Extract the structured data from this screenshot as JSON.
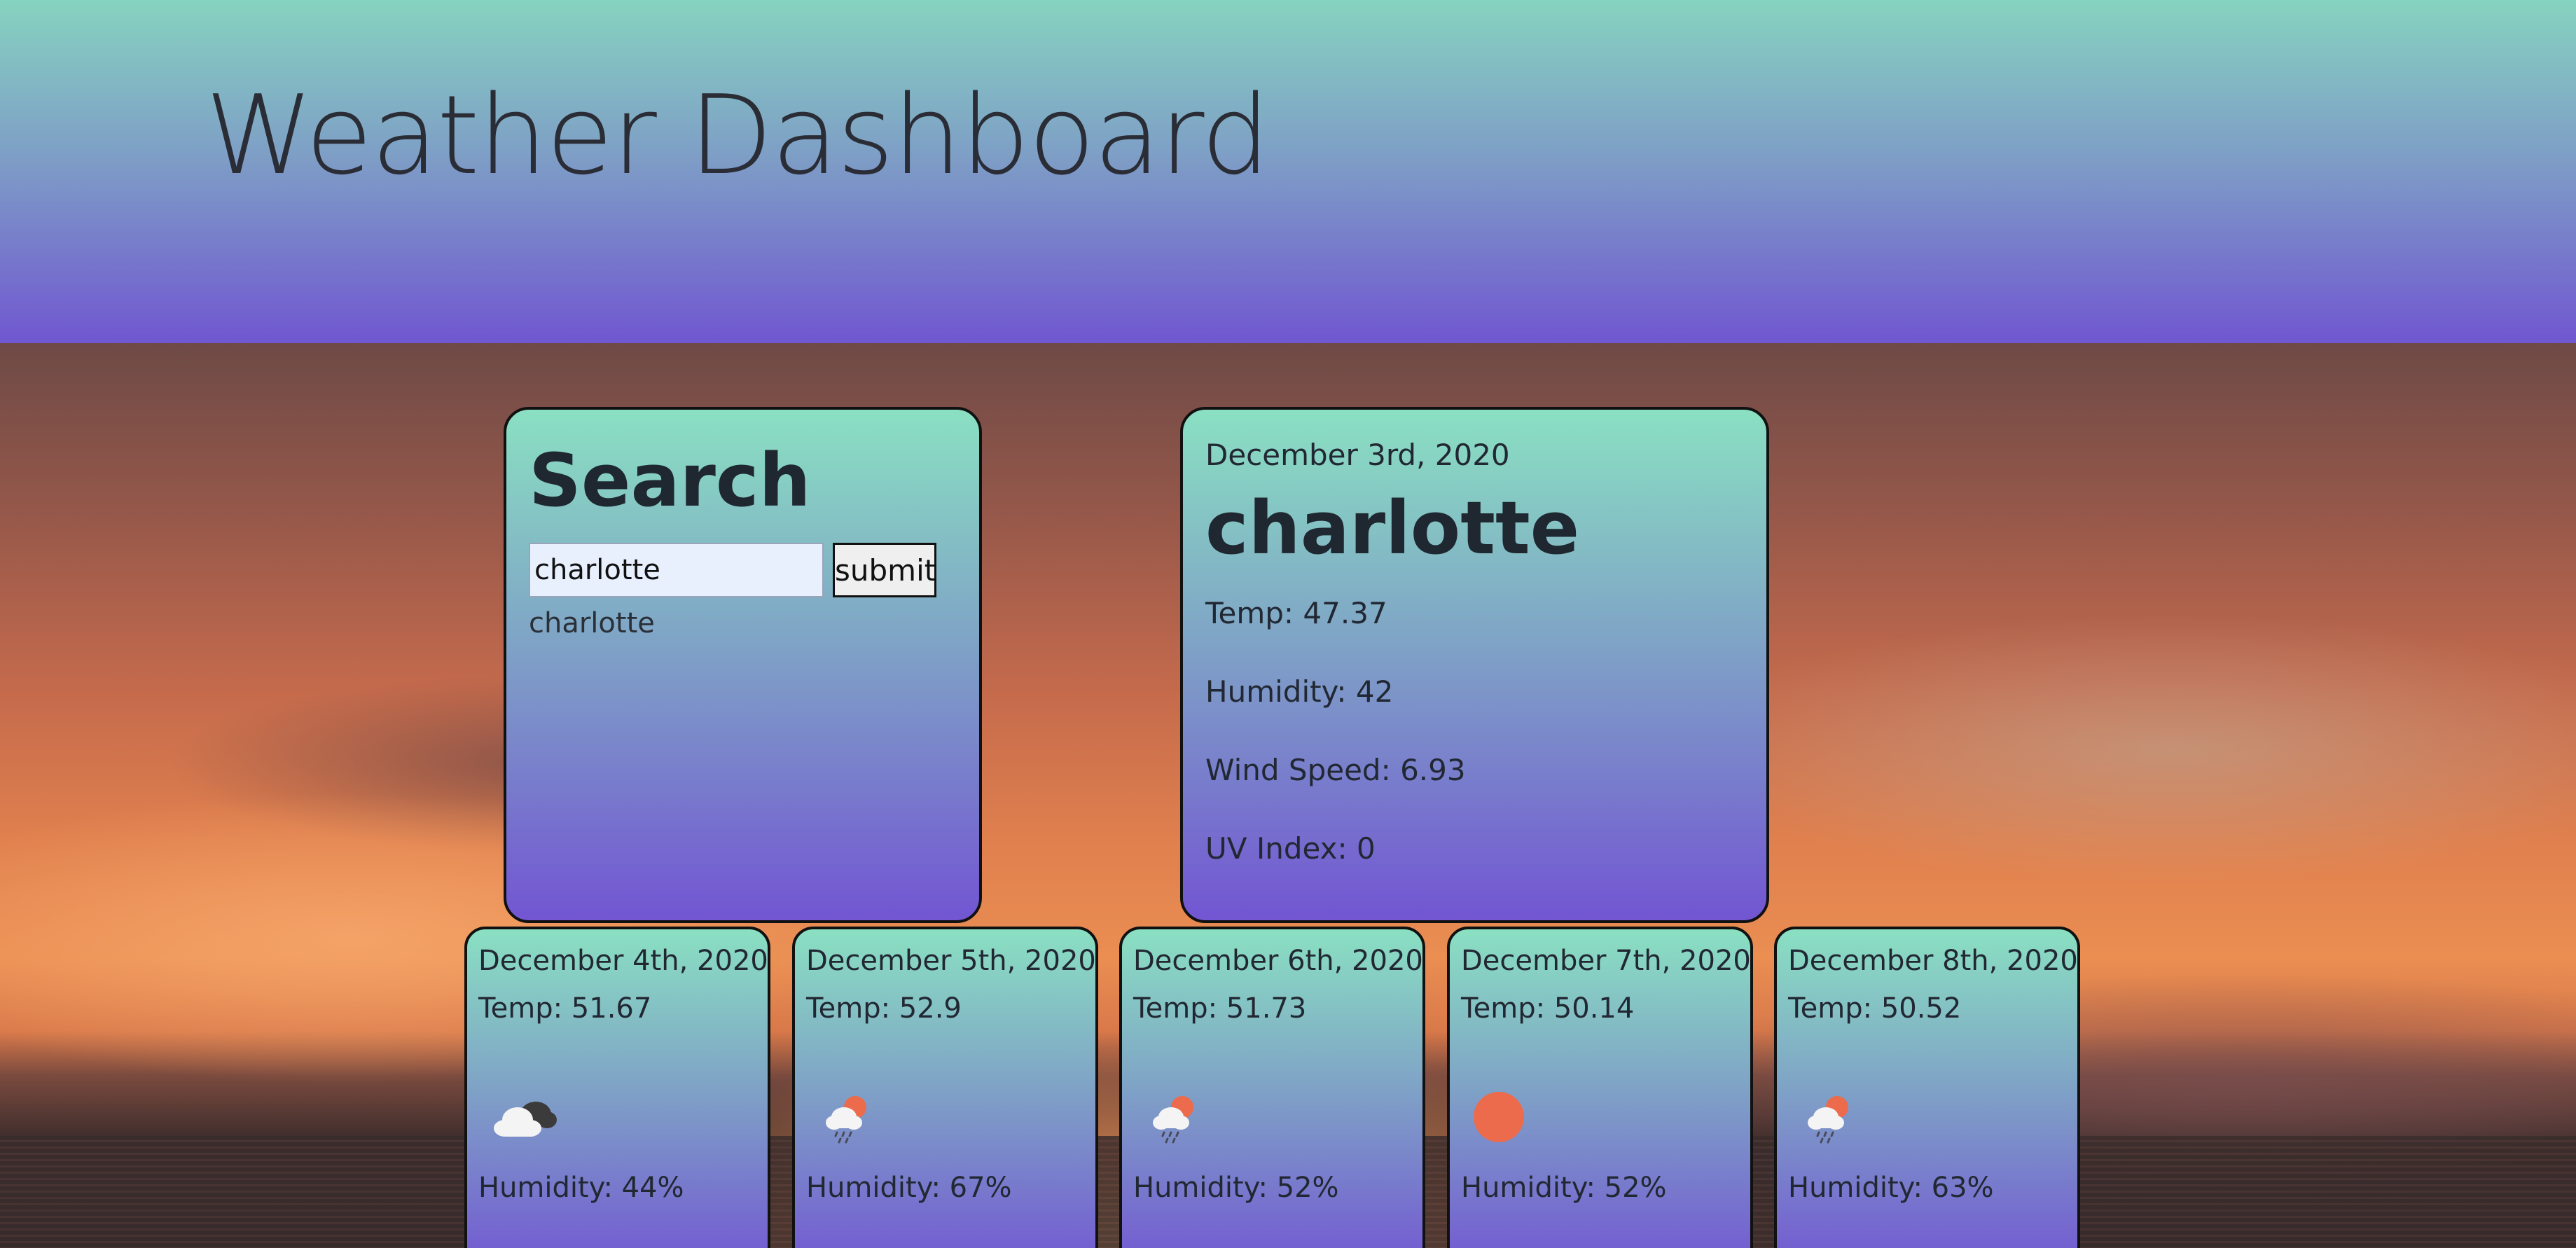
{
  "header": {
    "title": "Weather Dashboard"
  },
  "search": {
    "title": "Search",
    "input_value": "charlotte",
    "submit_label": "submit",
    "history": [
      "charlotte"
    ]
  },
  "current": {
    "date": "December 3rd, 2020",
    "city": "charlotte",
    "temp": "Temp: 47.37",
    "humidity": "Humidity: 42",
    "wind": "Wind Speed: 6.93",
    "uv": "UV Index: 0"
  },
  "forecast": [
    {
      "date": "December 4th, 2020",
      "temp": "Temp: 51.67",
      "humidity": "Humidity: 44%",
      "icon": "broken-clouds-icon"
    },
    {
      "date": "December 5th, 2020",
      "temp": "Temp: 52.9",
      "humidity": "Humidity: 67%",
      "icon": "rain-sun-icon"
    },
    {
      "date": "December 6th, 2020",
      "temp": "Temp: 51.73",
      "humidity": "Humidity: 52%",
      "icon": "rain-sun-icon"
    },
    {
      "date": "December 7th, 2020",
      "temp": "Temp: 50.14",
      "humidity": "Humidity: 52%",
      "icon": "clear-sun-icon"
    },
    {
      "date": "December 8th, 2020",
      "temp": "Temp: 50.52",
      "humidity": "Humidity: 63%",
      "icon": "rain-sun-icon"
    }
  ],
  "colors": {
    "card_top": "#8ae0c2",
    "card_bottom": "#7255d2",
    "sun": "#ec6b4c"
  }
}
